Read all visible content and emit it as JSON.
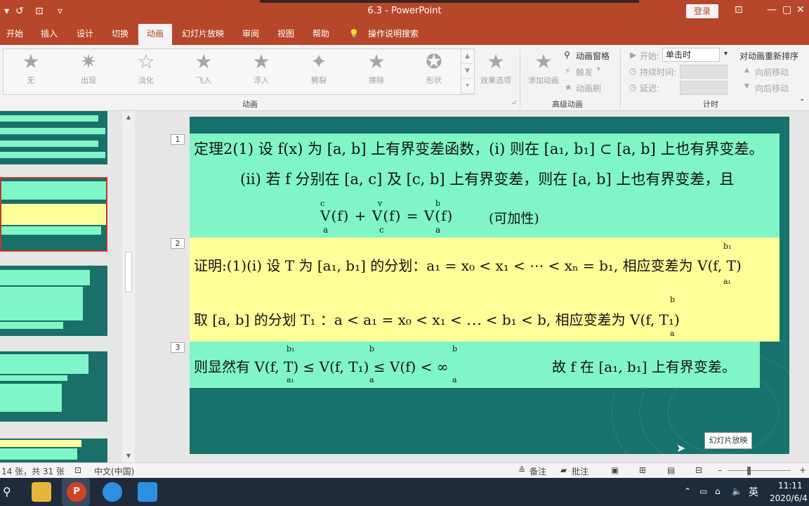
{
  "window": {
    "title": "6.3  -  PowerPoint",
    "login": "登录",
    "minimize": "—",
    "restore": "▢",
    "close": "✕",
    "ribbon_toggle": "⊡"
  },
  "quick_access": {
    "back": "▾",
    "redo": "↺",
    "present": "⊡",
    "more": "▿"
  },
  "tabs": [
    "开始",
    "插入",
    "设计",
    "切换",
    "动画",
    "幻灯片放映",
    "审阅",
    "视图",
    "帮助",
    "操作说明搜索"
  ],
  "ribbon": {
    "animations": [
      "无",
      "出现",
      "淡化",
      "飞入",
      "浮入",
      "劈裂",
      "擦除",
      "形状"
    ],
    "effect_options": "效果选项",
    "group_animation": "动画",
    "add_animation": "添加动画",
    "animation_pane": "动画窗格",
    "trigger": "触发",
    "animation_painter": "动画刷",
    "group_advanced": "高级动画",
    "start_label": "开始:",
    "start_value": "单击时",
    "duration_label": "持续时间:",
    "delay_label": "延迟:",
    "group_timing": "计时",
    "reorder": "对动画重新排序",
    "move_earlier": "向前移动",
    "move_later": "向后移动"
  },
  "slide": {
    "seq": [
      "1",
      "2",
      "3"
    ],
    "line1": "定理2(1) 设 f(x) 为 [a, b] 上有界变差函数，(i) 则在 [a₁, b₁] ⊂ [a, b] 上也有界变差。",
    "line2": "(ii) 若 f 分别在 [a, c] 及 [c, b] 上有界变差，则在 [a, b] 上也有界变差，且",
    "line3_formula": "V(f) + V(f) = V(f)",
    "line3_sup": [
      "c",
      "v",
      "b"
    ],
    "line3_sub": [
      "a",
      "c",
      "a"
    ],
    "line3_note": "(可加性)",
    "proof1": "证明:(1)(i) 设 T 为 [a₁, b₁] 的分划：a₁ = x₀ < x₁ < ⋯ < xₙ = b₁, 相应变差为 V(f, T)",
    "proof1_sup": "b₁",
    "proof1_sub": "a₁",
    "proof2": "取 [a, b] 的分划 T₁ ：a < a₁ = x₀ < x₁ < ⋯ < b₁ < b, 相应变差为 V(f, T₁)",
    "proof2_sup": "b",
    "proof2_sub": "a",
    "proof3": "则显然有  V(f, T) ≤ V(f, T₁) ≤ V(f) < ∞",
    "proof3_sup": [
      "b₁",
      "b",
      "b"
    ],
    "proof3_sub": [
      "a₁",
      "a",
      "a"
    ],
    "proof3_tail": "故 f 在 [a₁, b₁] 上有界变差。"
  },
  "tooltip": "幻灯片放映",
  "status": {
    "slide_count": "14 张，共 31 张",
    "language": "中文(中国)",
    "notes": "备注",
    "comments": "批注"
  },
  "taskbar": {
    "time": "11:11",
    "date": "2020/6/4",
    "ime": "英"
  }
}
